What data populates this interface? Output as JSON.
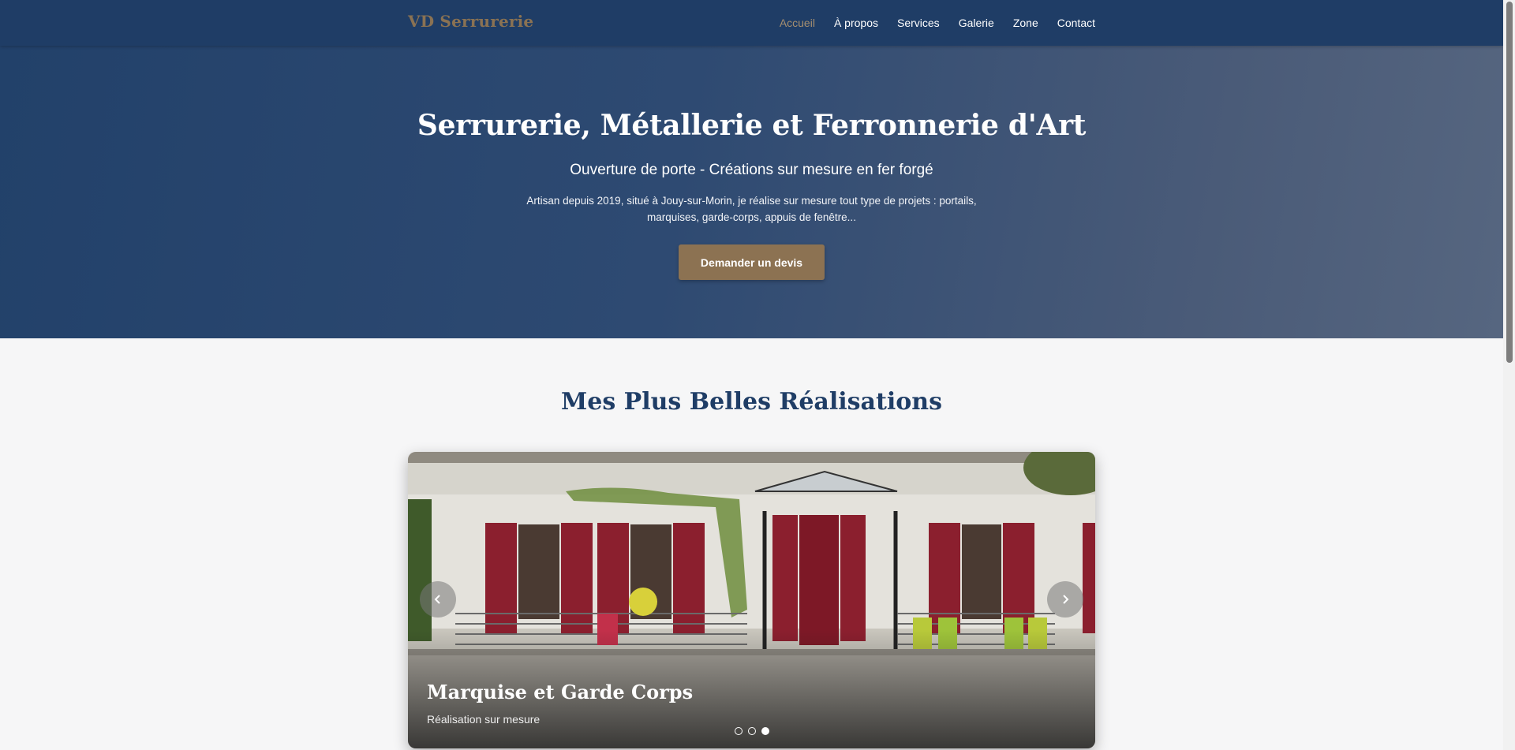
{
  "header": {
    "brand": "VD Serrurerie",
    "nav": [
      {
        "label": "Accueil",
        "active": true
      },
      {
        "label": "À propos",
        "active": false
      },
      {
        "label": "Services",
        "active": false
      },
      {
        "label": "Galerie",
        "active": false
      },
      {
        "label": "Zone",
        "active": false
      },
      {
        "label": "Contact",
        "active": false
      }
    ]
  },
  "hero": {
    "title": "Serrurerie, Métallerie et Ferronnerie d'Art",
    "subtitle": "Ouverture de porte - Créations sur mesure en fer forgé",
    "description": "Artisan depuis 2019, situé à Jouy-sur-Morin, je réalise sur mesure tout type de projets : portails, marquises, garde-corps, appuis de fenêtre...",
    "cta_label": "Demander un devis"
  },
  "gallery": {
    "title": "Mes Plus Belles Réalisations",
    "slide": {
      "title": "Marquise et Garde Corps",
      "subtitle": "Réalisation sur mesure"
    },
    "slide_count": 3,
    "active_slide": 3,
    "prev_icon": "chevron-left-icon",
    "next_icon": "chevron-right-icon"
  },
  "colors": {
    "navbar": "#1f3d66",
    "brand": "#8a7253",
    "accent": "#8c7252",
    "heading": "#1f3d66"
  }
}
